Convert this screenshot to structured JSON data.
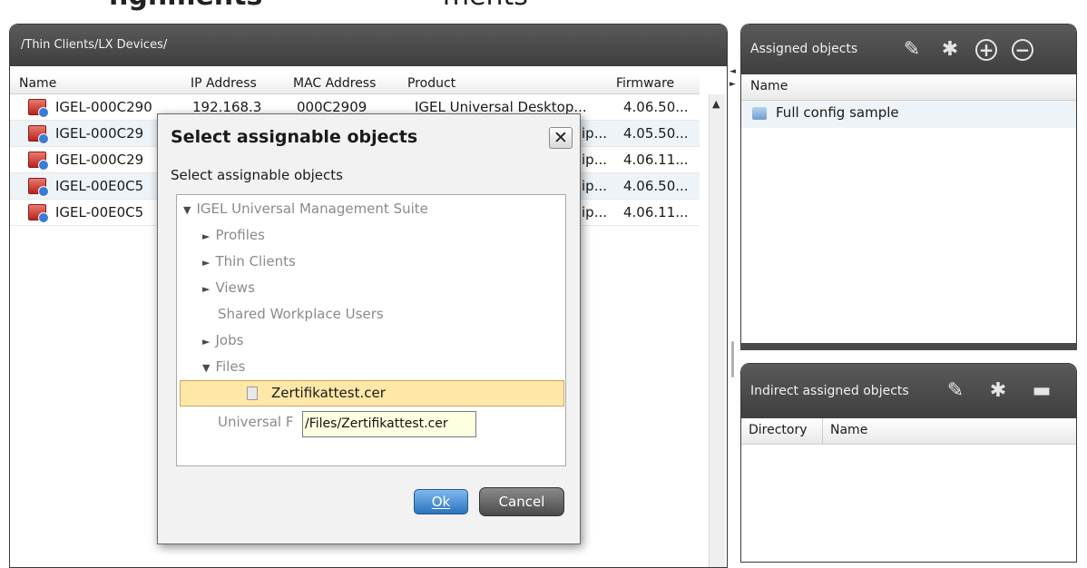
{
  "heading": {
    "part1": "ngnments",
    "part2": "ments"
  },
  "main": {
    "path": "/Thin Clients/LX Devices/",
    "columns": [
      "Name",
      "IP Address",
      "MAC Address",
      "Product",
      "Firmware"
    ],
    "rows": [
      {
        "name": "IGEL-000C290",
        "ip": "192.168.3",
        "mac": "000C2909",
        "product": "IGEL Universal Desktop...",
        "firmware": "4.06.50..."
      },
      {
        "name": "IGEL-000C29",
        "ip": "",
        "mac": "",
        "product": "ip...",
        "firmware": "4.05.50..."
      },
      {
        "name": "IGEL-000C29",
        "ip": "",
        "mac": "",
        "product": "ip...",
        "firmware": "4.06.11..."
      },
      {
        "name": "IGEL-00E0C5",
        "ip": "",
        "mac": "",
        "product": "ip...",
        "firmware": "4.06.50..."
      },
      {
        "name": "IGEL-00E0C5",
        "ip": "",
        "mac": "",
        "product": "ip...",
        "firmware": "4.06.11..."
      }
    ]
  },
  "assigned": {
    "title": "Assigned objects",
    "column": "Name",
    "items": [
      "Full config sample"
    ],
    "icons": [
      "edit-icon",
      "snowflake-icon",
      "add-icon",
      "remove-icon"
    ]
  },
  "indirect": {
    "title": "Indirect assigned objects",
    "columns": [
      "Directory",
      "Name"
    ],
    "icons": [
      "edit-icon",
      "snowflake-icon",
      "folder-icon"
    ]
  },
  "dialog": {
    "title": "Select assignable objects",
    "subtitle": "Select assignable objects",
    "tree": {
      "root": "IGEL Universal Management Suite",
      "profiles": "Profiles",
      "thin_clients": "Thin Clients",
      "views": "Views",
      "shared": "Shared Workplace Users",
      "jobs": "Jobs",
      "files": "Files",
      "selected_file": "Zertifikattest.cer",
      "universal": "Universal F"
    },
    "tooltip": "/Files/Zertifikattest.cer",
    "ok_label": "Ok",
    "cancel_label": "Cancel"
  }
}
